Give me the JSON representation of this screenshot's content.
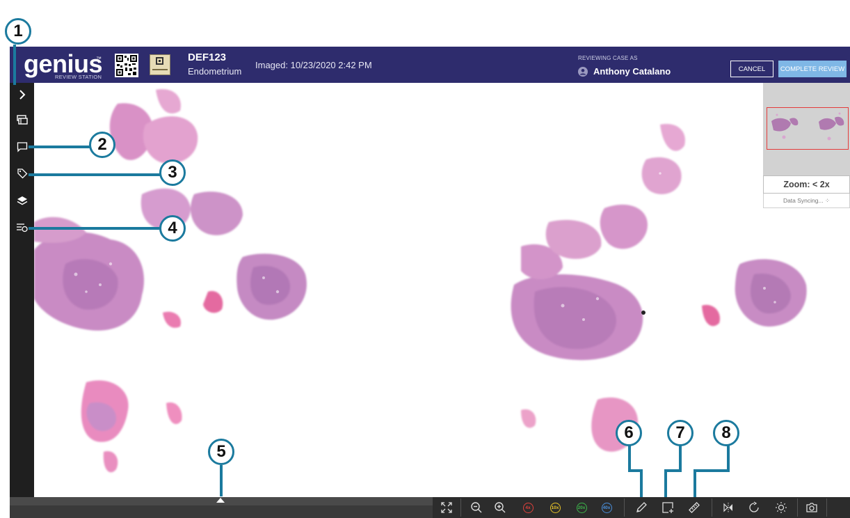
{
  "header": {
    "logo": "genius",
    "logo_tm": "™",
    "logo_subtitle": "REVIEW STATION",
    "case_id": "DEF123",
    "case_type": "Endometrium",
    "imaged": "Imaged: 10/23/2020 2:42 PM",
    "reviewing_label": "REVIEWING CASE AS",
    "reviewer": "Anthony Catalano",
    "cancel_label": "CANCEL",
    "complete_label": "COMPLETE REVIEW"
  },
  "sidebar": {
    "items": [
      {
        "icon": "chevron-right-icon"
      },
      {
        "icon": "slides-icon"
      },
      {
        "icon": "comment-icon"
      },
      {
        "icon": "tag-icon"
      },
      {
        "icon": "layers-icon"
      },
      {
        "icon": "list-search-icon"
      }
    ]
  },
  "minimap": {
    "zoom": "Zoom: < 2x",
    "sync_status": "Data Syncing...  ⁘"
  },
  "toolbar": {
    "zoom_presets": [
      {
        "label": "4x",
        "color": "#e0413c"
      },
      {
        "label": "10x",
        "color": "#e6c229"
      },
      {
        "label": "20x",
        "color": "#3cb44a"
      },
      {
        "label": "40x",
        "color": "#4a8fdc"
      }
    ]
  },
  "callouts": [
    "1",
    "2",
    "3",
    "4",
    "5",
    "6",
    "7",
    "8"
  ],
  "colors": {
    "header": "#2e2c6d",
    "accent": "#1b7a9e",
    "complete_button": "#7fb7e6",
    "tissue": "#d98bc0"
  }
}
